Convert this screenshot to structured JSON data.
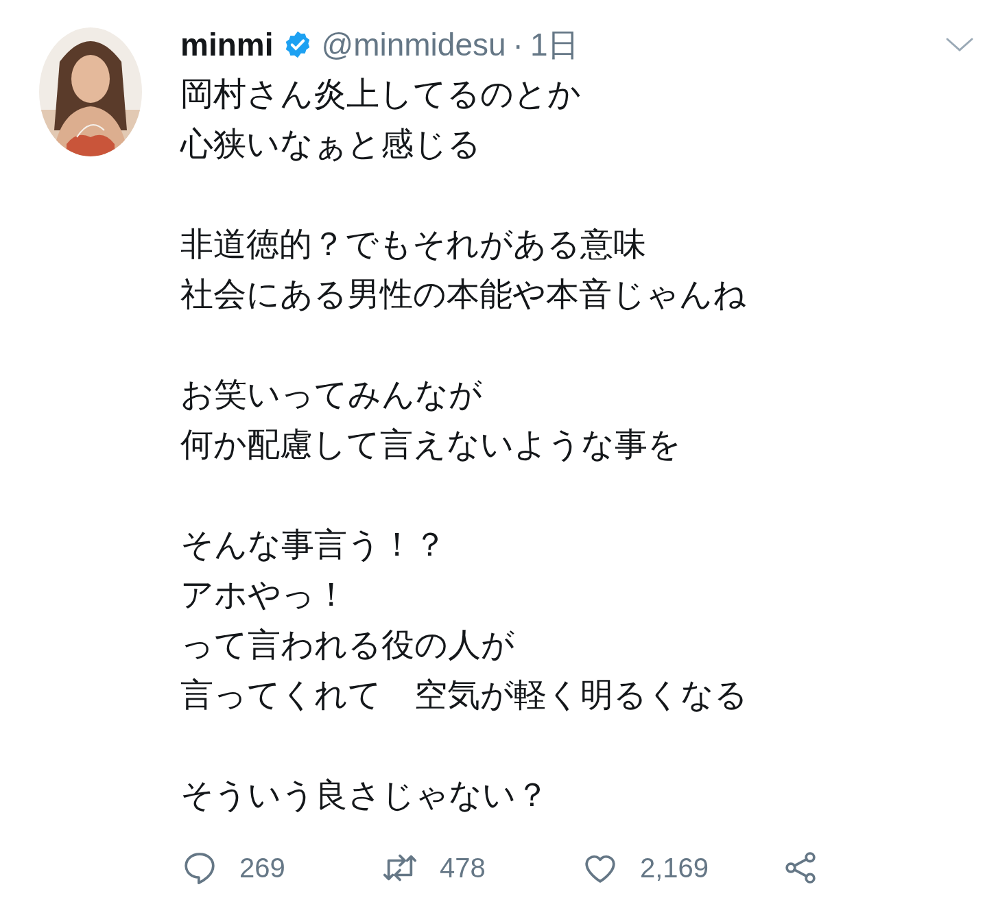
{
  "tweet": {
    "author": {
      "name": "minmi",
      "verified": true,
      "handle": "@minmidesu",
      "separator": "·",
      "time": "1日"
    },
    "paragraphs": [
      [
        "岡村さん炎上してるのとか",
        "心狭いなぁと感じる"
      ],
      [
        "非道徳的？でもそれがある意味",
        "社会にある男性の本能や本音じゃんね"
      ],
      [
        "お笑いってみんなが",
        "何か配慮して言えないような事を"
      ],
      [
        "そんな事言う！？",
        "アホやっ！",
        "って言われる役の人が",
        "言ってくれて　空気が軽く明るくなる"
      ],
      [
        "そういう良さじゃない？"
      ]
    ],
    "actions": [
      {
        "kind": "reply",
        "count": "269"
      },
      {
        "kind": "retweet",
        "count": "478"
      },
      {
        "kind": "like",
        "count": "2,169"
      },
      {
        "kind": "share"
      }
    ]
  }
}
